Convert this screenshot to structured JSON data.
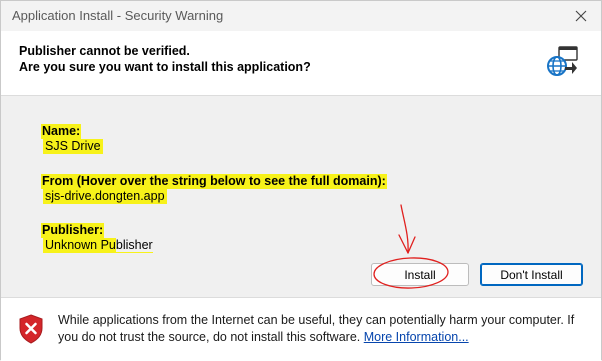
{
  "window": {
    "title": "Application Install - Security Warning",
    "close_glyph": "✕"
  },
  "header": {
    "line1": "Publisher cannot be verified.",
    "line2": "Are you sure you want to install this application?",
    "icon": "globe-app-install-icon"
  },
  "details": {
    "name_label": "Name:",
    "name_value": "SJS Drive",
    "from_label": "From (Hover over the string below to see the full domain):",
    "from_value": "sjs-drive.dongten.app",
    "publisher_label": "Publisher:",
    "publisher_value_highlighted": "Unknown Pu",
    "publisher_value_rest": "blisher"
  },
  "buttons": {
    "install": "Install",
    "dont_install": "Don't Install"
  },
  "footer": {
    "warning_text": "While applications from the Internet can be useful, they can potentially harm your computer. If you do not trust the source, do not install this software.",
    "more_link": "More Information...",
    "icon": "shield-warning-icon"
  },
  "colors": {
    "highlight": "#f7f21a",
    "annotation_red": "#e0201e",
    "link_blue": "#0645ad",
    "default_button_border": "#0067c0"
  }
}
